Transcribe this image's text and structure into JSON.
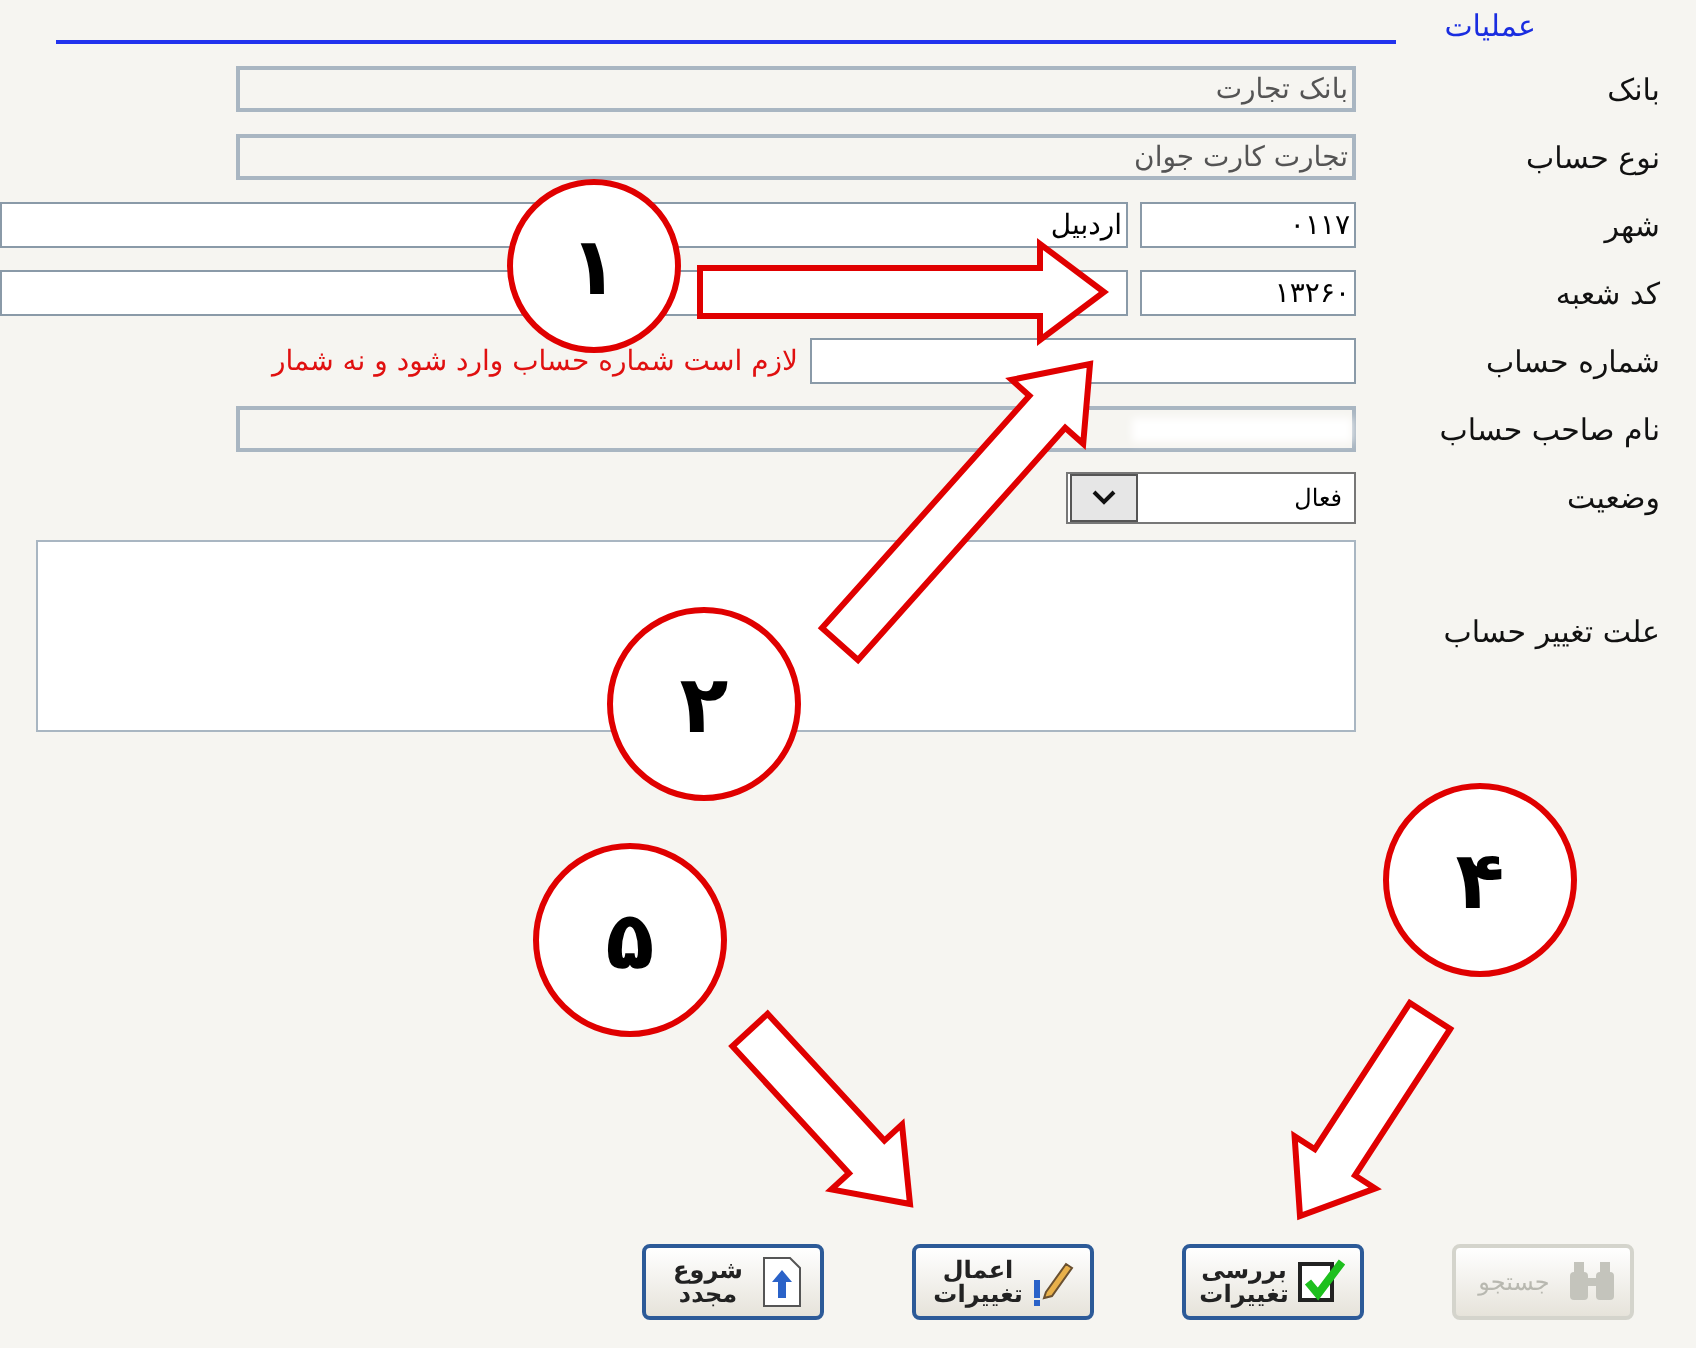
{
  "section": {
    "title": "عملیات"
  },
  "fields": [
    {
      "label": "بانک",
      "kind": "text",
      "value": "بانک تجارت",
      "disabled": true
    },
    {
      "label": "نوع حساب",
      "kind": "text",
      "value": "تجارت کارت جوان",
      "disabled": true
    },
    {
      "label": "شهر",
      "kind": "pair",
      "code": "۰۱۱۷",
      "value": "اردبیل"
    },
    {
      "label": "کد شعبه",
      "kind": "pair",
      "code": "۱۳۲۶۰"
    },
    {
      "label": "شماره حساب",
      "kind": "message",
      "message": "لازم است شماره حساب وارد شود و نه شمار"
    },
    {
      "label": "نام صاحب حساب",
      "kind": "blurred",
      "disabled": true
    },
    {
      "label": "وضعیت",
      "kind": "select",
      "value": "فعال"
    },
    {
      "label": "علت تغییر حساب",
      "kind": "area"
    }
  ],
  "buttons": [
    {
      "label": "جستجو",
      "kind": "search",
      "disabled": true
    },
    {
      "label": "بررسی تغییرات",
      "kind": "check",
      "disabled": false
    },
    {
      "label": "اعمال تغییرات",
      "kind": "apply",
      "disabled": false
    },
    {
      "label": "شروع مجدد",
      "kind": "restart",
      "disabled": false
    }
  ],
  "markers": [
    {
      "number": "۱"
    },
    {
      "number": "۲"
    },
    {
      "number": "۴"
    },
    {
      "number": "۵"
    }
  ]
}
